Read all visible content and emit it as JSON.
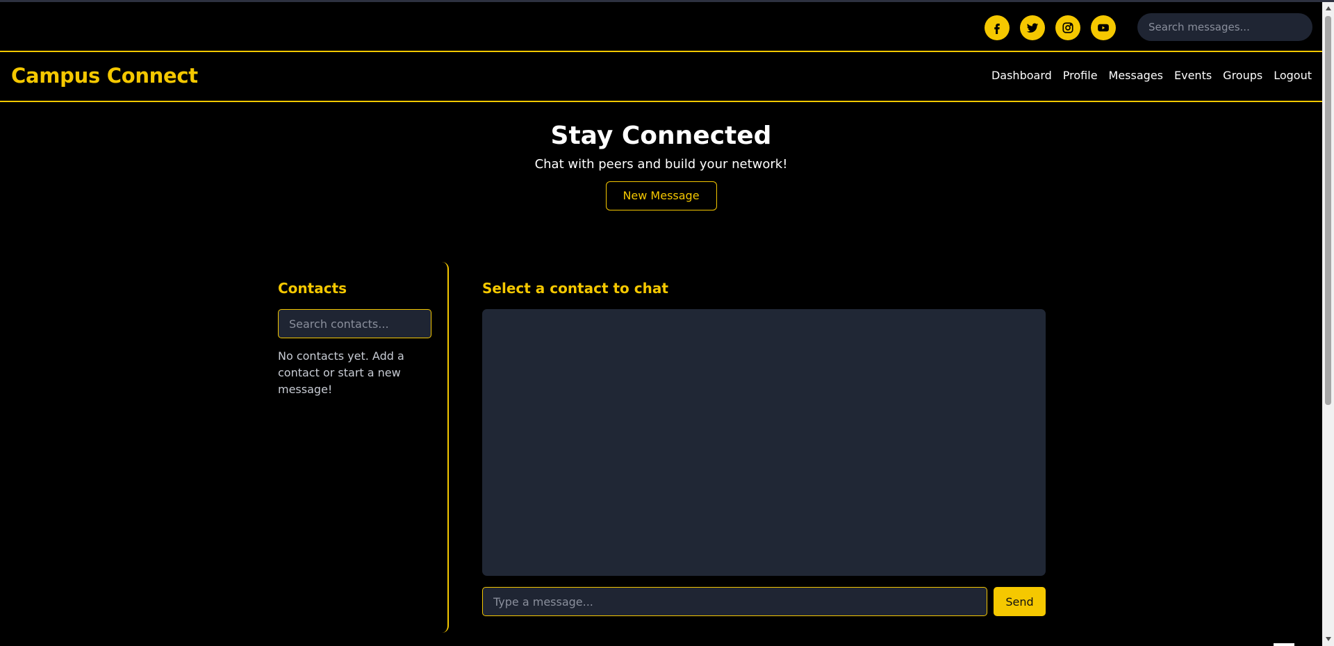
{
  "topbar": {
    "social": [
      {
        "name": "facebook-icon"
      },
      {
        "name": "twitter-icon"
      },
      {
        "name": "instagram-icon"
      },
      {
        "name": "youtube-icon"
      }
    ],
    "search_placeholder": "Search messages..."
  },
  "navbar": {
    "brand": "Campus Connect",
    "links": [
      "Dashboard",
      "Profile",
      "Messages",
      "Events",
      "Groups",
      "Logout"
    ]
  },
  "hero": {
    "title": "Stay Connected",
    "subtitle": "Chat with peers and build your network!",
    "button_label": "New Message"
  },
  "contacts": {
    "title": "Contacts",
    "search_placeholder": "Search contacts...",
    "empty_text": "No contacts yet. Add a contact or start a new message!"
  },
  "chat": {
    "title": "Select a contact to chat",
    "input_placeholder": "Type a message...",
    "send_label": "Send"
  },
  "colors": {
    "accent": "#f5c800",
    "background": "#000000",
    "panel": "#202735"
  }
}
